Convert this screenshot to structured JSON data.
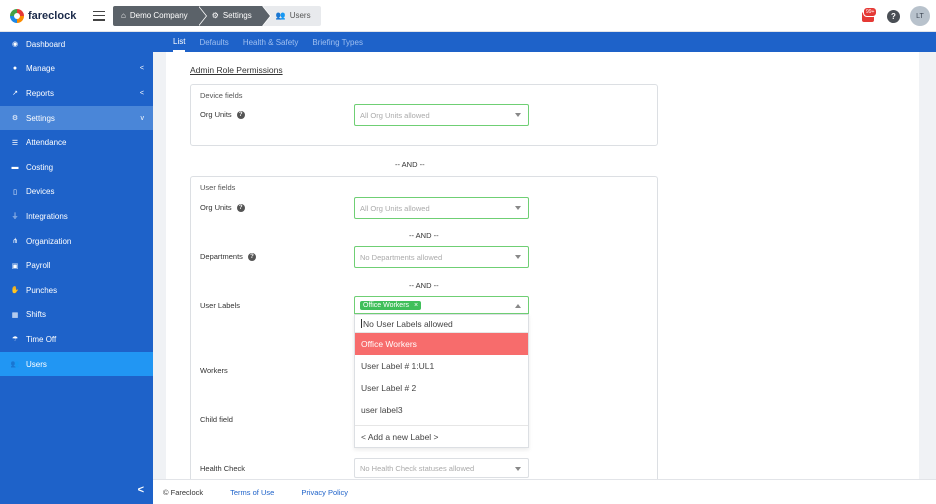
{
  "app": {
    "name": "fareclock"
  },
  "breadcrumbs": [
    "Demo Company",
    "Settings",
    "Users"
  ],
  "header": {
    "notification_count": "99+",
    "help": "?",
    "avatar_initials": "LT"
  },
  "sidebar": {
    "items": [
      {
        "label": "Dashboard",
        "icon": "dashboard-icon"
      },
      {
        "label": "Manage",
        "icon": "user-icon",
        "arrow": "<"
      },
      {
        "label": "Reports",
        "icon": "chart-icon",
        "arrow": "<"
      },
      {
        "label": "Settings",
        "icon": "gear-icon",
        "arrow": "v"
      },
      {
        "label": "Attendance",
        "icon": "attendance-icon"
      },
      {
        "label": "Costing",
        "icon": "folder-icon"
      },
      {
        "label": "Devices",
        "icon": "tablet-icon"
      },
      {
        "label": "Integrations",
        "icon": "plug-icon"
      },
      {
        "label": "Organization",
        "icon": "sitemap-icon"
      },
      {
        "label": "Payroll",
        "icon": "money-icon"
      },
      {
        "label": "Punches",
        "icon": "hand-icon"
      },
      {
        "label": "Shifts",
        "icon": "calendar-icon"
      },
      {
        "label": "Time Off",
        "icon": "umbrella-icon"
      },
      {
        "label": "Users",
        "icon": "users-icon"
      }
    ],
    "collapse": "<"
  },
  "subnav": {
    "tabs": [
      "List",
      "Defaults",
      "Health & Safety",
      "Briefing Types"
    ]
  },
  "content": {
    "section_title": "Admin Role Permissions",
    "device_fields": {
      "title": "Device fields",
      "org_units_label": "Org Units",
      "org_units_placeholder": "All Org Units allowed"
    },
    "and": "-- AND --",
    "user_fields": {
      "title": "User fields",
      "org_units_label": "Org Units",
      "org_units_placeholder": "All Org Units allowed",
      "departments_label": "Departments",
      "departments_placeholder": "No Departments allowed",
      "user_labels_label": "User Labels",
      "selected_chip": "Office Workers",
      "chip_remove": "×",
      "workers_label": "Workers",
      "child_field_label": "Child field",
      "health_check_label": "Health Check",
      "health_check_placeholder": "No Health Check statuses allowed"
    },
    "dropdown": {
      "search_text": "No User Labels allowed",
      "options": [
        "Office Workers",
        "User Label # 1:UL1",
        "User Label # 2",
        "user label3"
      ],
      "add_new": "< Add a new Label >"
    }
  },
  "footer": {
    "copyright": "© Fareclock",
    "terms": "Terms of Use",
    "privacy": "Privacy Policy"
  }
}
